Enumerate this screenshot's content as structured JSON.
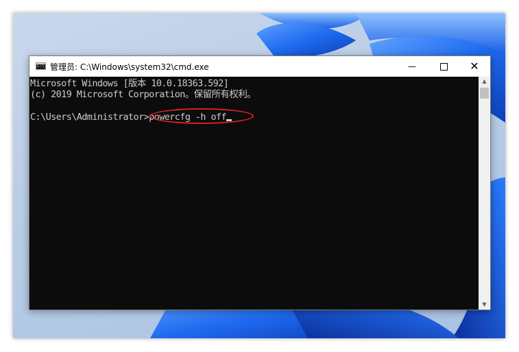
{
  "window": {
    "title": "管理员: C:\\Windows\\system32\\cmd.exe",
    "icon": "cmd-icon",
    "icon_glyph": "C:\\",
    "minimize_glyph": "—",
    "close_glyph": "✕"
  },
  "console": {
    "lines": [
      "Microsoft Windows [版本 10.0.18363.592]",
      "(c) 2019 Microsoft Corporation。保留所有权利。"
    ],
    "prompt": "C:\\Users\\Administrator>",
    "command": "powercfg -h off"
  },
  "scrollbar": {
    "up_glyph": "▲",
    "down_glyph": "▼"
  },
  "colors": {
    "console_bg": "#0c0c0c",
    "console_text": "#cccccc",
    "highlight": "#e32020",
    "wallpaper_accent": "#1a5fe0"
  }
}
